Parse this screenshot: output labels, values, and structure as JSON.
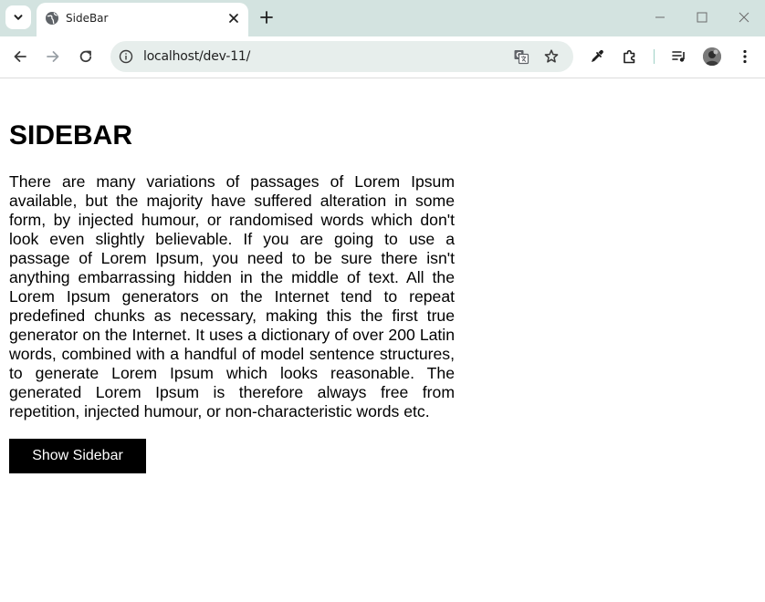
{
  "browser": {
    "tab": {
      "title": "SideBar"
    },
    "address_bar": {
      "url": "localhost/dev-11/"
    }
  },
  "page": {
    "heading": "SIDEBAR",
    "paragraph": "There are many variations of passages of Lorem Ipsum available, but the majority have suffered alteration in some form, by injected humour, or randomised words which don't look even slightly believable. If you are going to use a passage of Lorem Ipsum, you need to be sure there isn't anything embarrassing hidden in the middle of text. All the Lorem Ipsum generators on the Internet tend to repeat predefined chunks as necessary, making this the first true generator on the Internet. It uses a dictionary of over 200 Latin words, combined with a handful of model sentence structures, to generate Lorem Ipsum which looks reasonable. The generated Lorem Ipsum is therefore always free from repetition, injected humour, or non-characteristic words etc.",
    "button_label": "Show Sidebar"
  },
  "icons": {
    "tab_search": "chevron-down-icon",
    "favicon": "globe-icon",
    "tab_close": "close-icon",
    "new_tab": "plus-icon",
    "back": "arrow-left-icon",
    "forward": "arrow-right-icon",
    "reload": "reload-icon",
    "site_info": "info-icon",
    "translate": "translate-icon",
    "bookmark": "star-icon",
    "eyedropper": "eyedropper-icon",
    "extensions": "puzzle-icon",
    "media": "media-controls-icon",
    "profile": "avatar",
    "menu": "kebab-menu-icon"
  },
  "colors": {
    "titlebar_bg": "#d3e3e0",
    "omnibox_bg": "#e7eeec",
    "button_bg": "#000000",
    "button_text": "#ffffff"
  }
}
